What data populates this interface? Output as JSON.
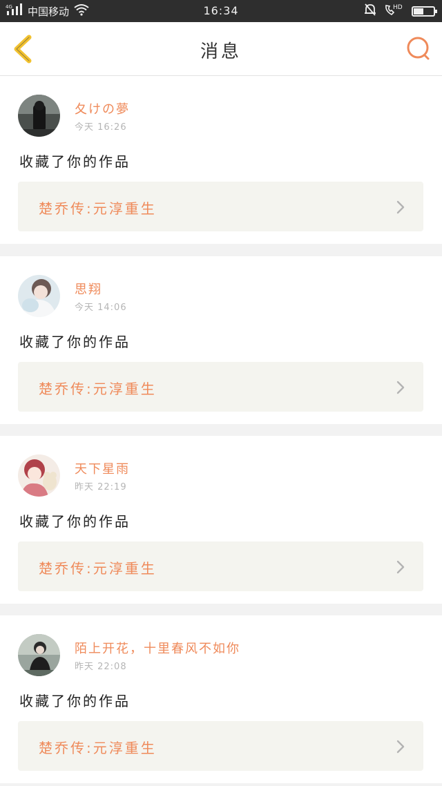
{
  "status_bar": {
    "network": "4G",
    "carrier": "中国移动",
    "time": "16:34",
    "call_label": "HD",
    "battery_level": 0.5,
    "icons": [
      "signal-icon",
      "wifi-icon",
      "bell-muted-icon",
      "phone-hd-icon",
      "battery-icon"
    ]
  },
  "header": {
    "title": "消息",
    "back_icon": "back-chevron-icon",
    "search_icon": "search-icon"
  },
  "colors": {
    "accent": "#ef8a5a",
    "back_icon": "#f2c230",
    "background": "#f2f2f2",
    "card": "#ffffff",
    "work_box": "#f4f4ef"
  },
  "messages": [
    {
      "username": "夂けの夢",
      "time": "今天 16:26",
      "action": "收藏了你的作品",
      "work_title": "楚乔传:元淳重生"
    },
    {
      "username": "思翔",
      "time": "今天 14:06",
      "action": "收藏了你的作品",
      "work_title": "楚乔传:元淳重生"
    },
    {
      "username": "天下星雨",
      "time": "昨天 22:19",
      "action": "收藏了你的作品",
      "work_title": "楚乔传:元淳重生"
    },
    {
      "username": "陌上开花，十里春风不如你",
      "time": "昨天 22:08",
      "action": "收藏了你的作品",
      "work_title": "楚乔传:元淳重生"
    }
  ]
}
